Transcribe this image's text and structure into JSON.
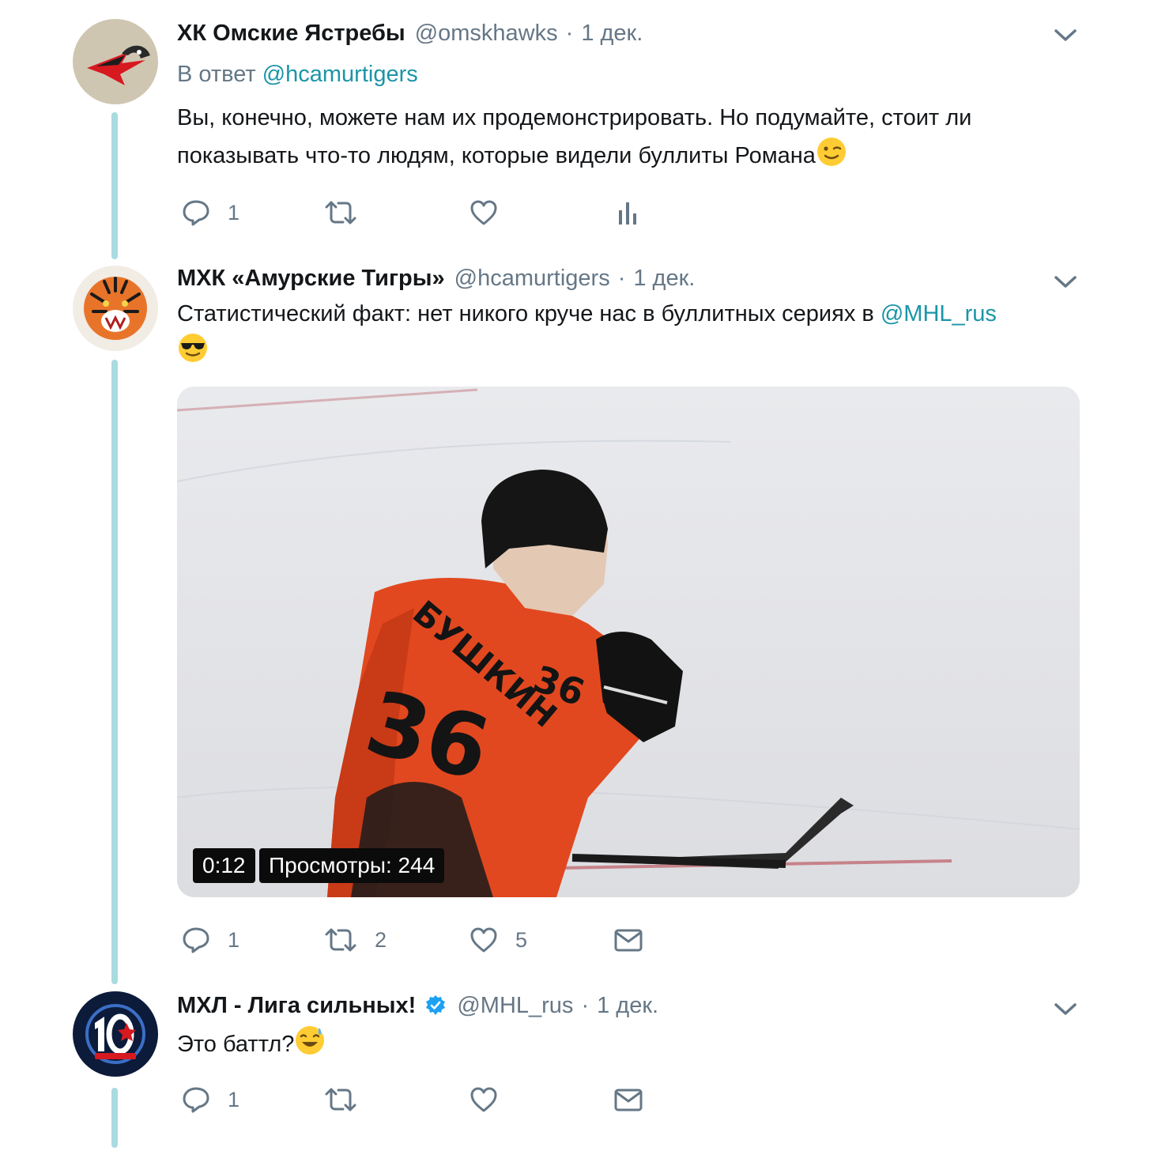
{
  "tweets": [
    {
      "author_name": "ХК Омские Ястребы",
      "handle": "@omskhawks",
      "time": "1 дек.",
      "reply_prefix": "В ответ",
      "reply_handle": "@hcamurtigers",
      "text_line1": "Вы, конечно, можете нам их продемонстрировать. Но подумайте, стоит ли",
      "text_line2": "показывать что-то людям, которые видели буллиты Романа",
      "emoji": "winking-face",
      "reply_count": "1",
      "retweet_count": "",
      "like_count": "",
      "fourth_action": "analytics-icon"
    },
    {
      "author_name": "МХК «Амурские Тигры»",
      "handle": "@hcamurtigers",
      "time": "1 дек.",
      "text_line1": "Статистический факт: нет никого круче нас в буллитных сериях в",
      "mention": "@MHL_rus",
      "emoji": "sunglasses-face",
      "video": {
        "duration": "0:12",
        "views": "Просмотры: 244",
        "jersey_name": "БУШКИН",
        "jersey_number": "36"
      },
      "reply_count": "1",
      "retweet_count": "2",
      "like_count": "5",
      "fourth_action": "mail-icon"
    },
    {
      "author_name": "МХЛ - Лига сильных!",
      "handle": "@MHL_rus",
      "time": "1 дек.",
      "verified": true,
      "text_line1": "Это баттл?",
      "emoji": "grinning-sweat-face",
      "reply_count": "1",
      "retweet_count": "",
      "like_count": "",
      "fourth_action": "mail-icon"
    }
  ],
  "separator": "·",
  "colors": {
    "thread_line": "#a9dbe0",
    "link": "#1b95a8",
    "muted": "#657786",
    "verified": "#1da1f2"
  }
}
